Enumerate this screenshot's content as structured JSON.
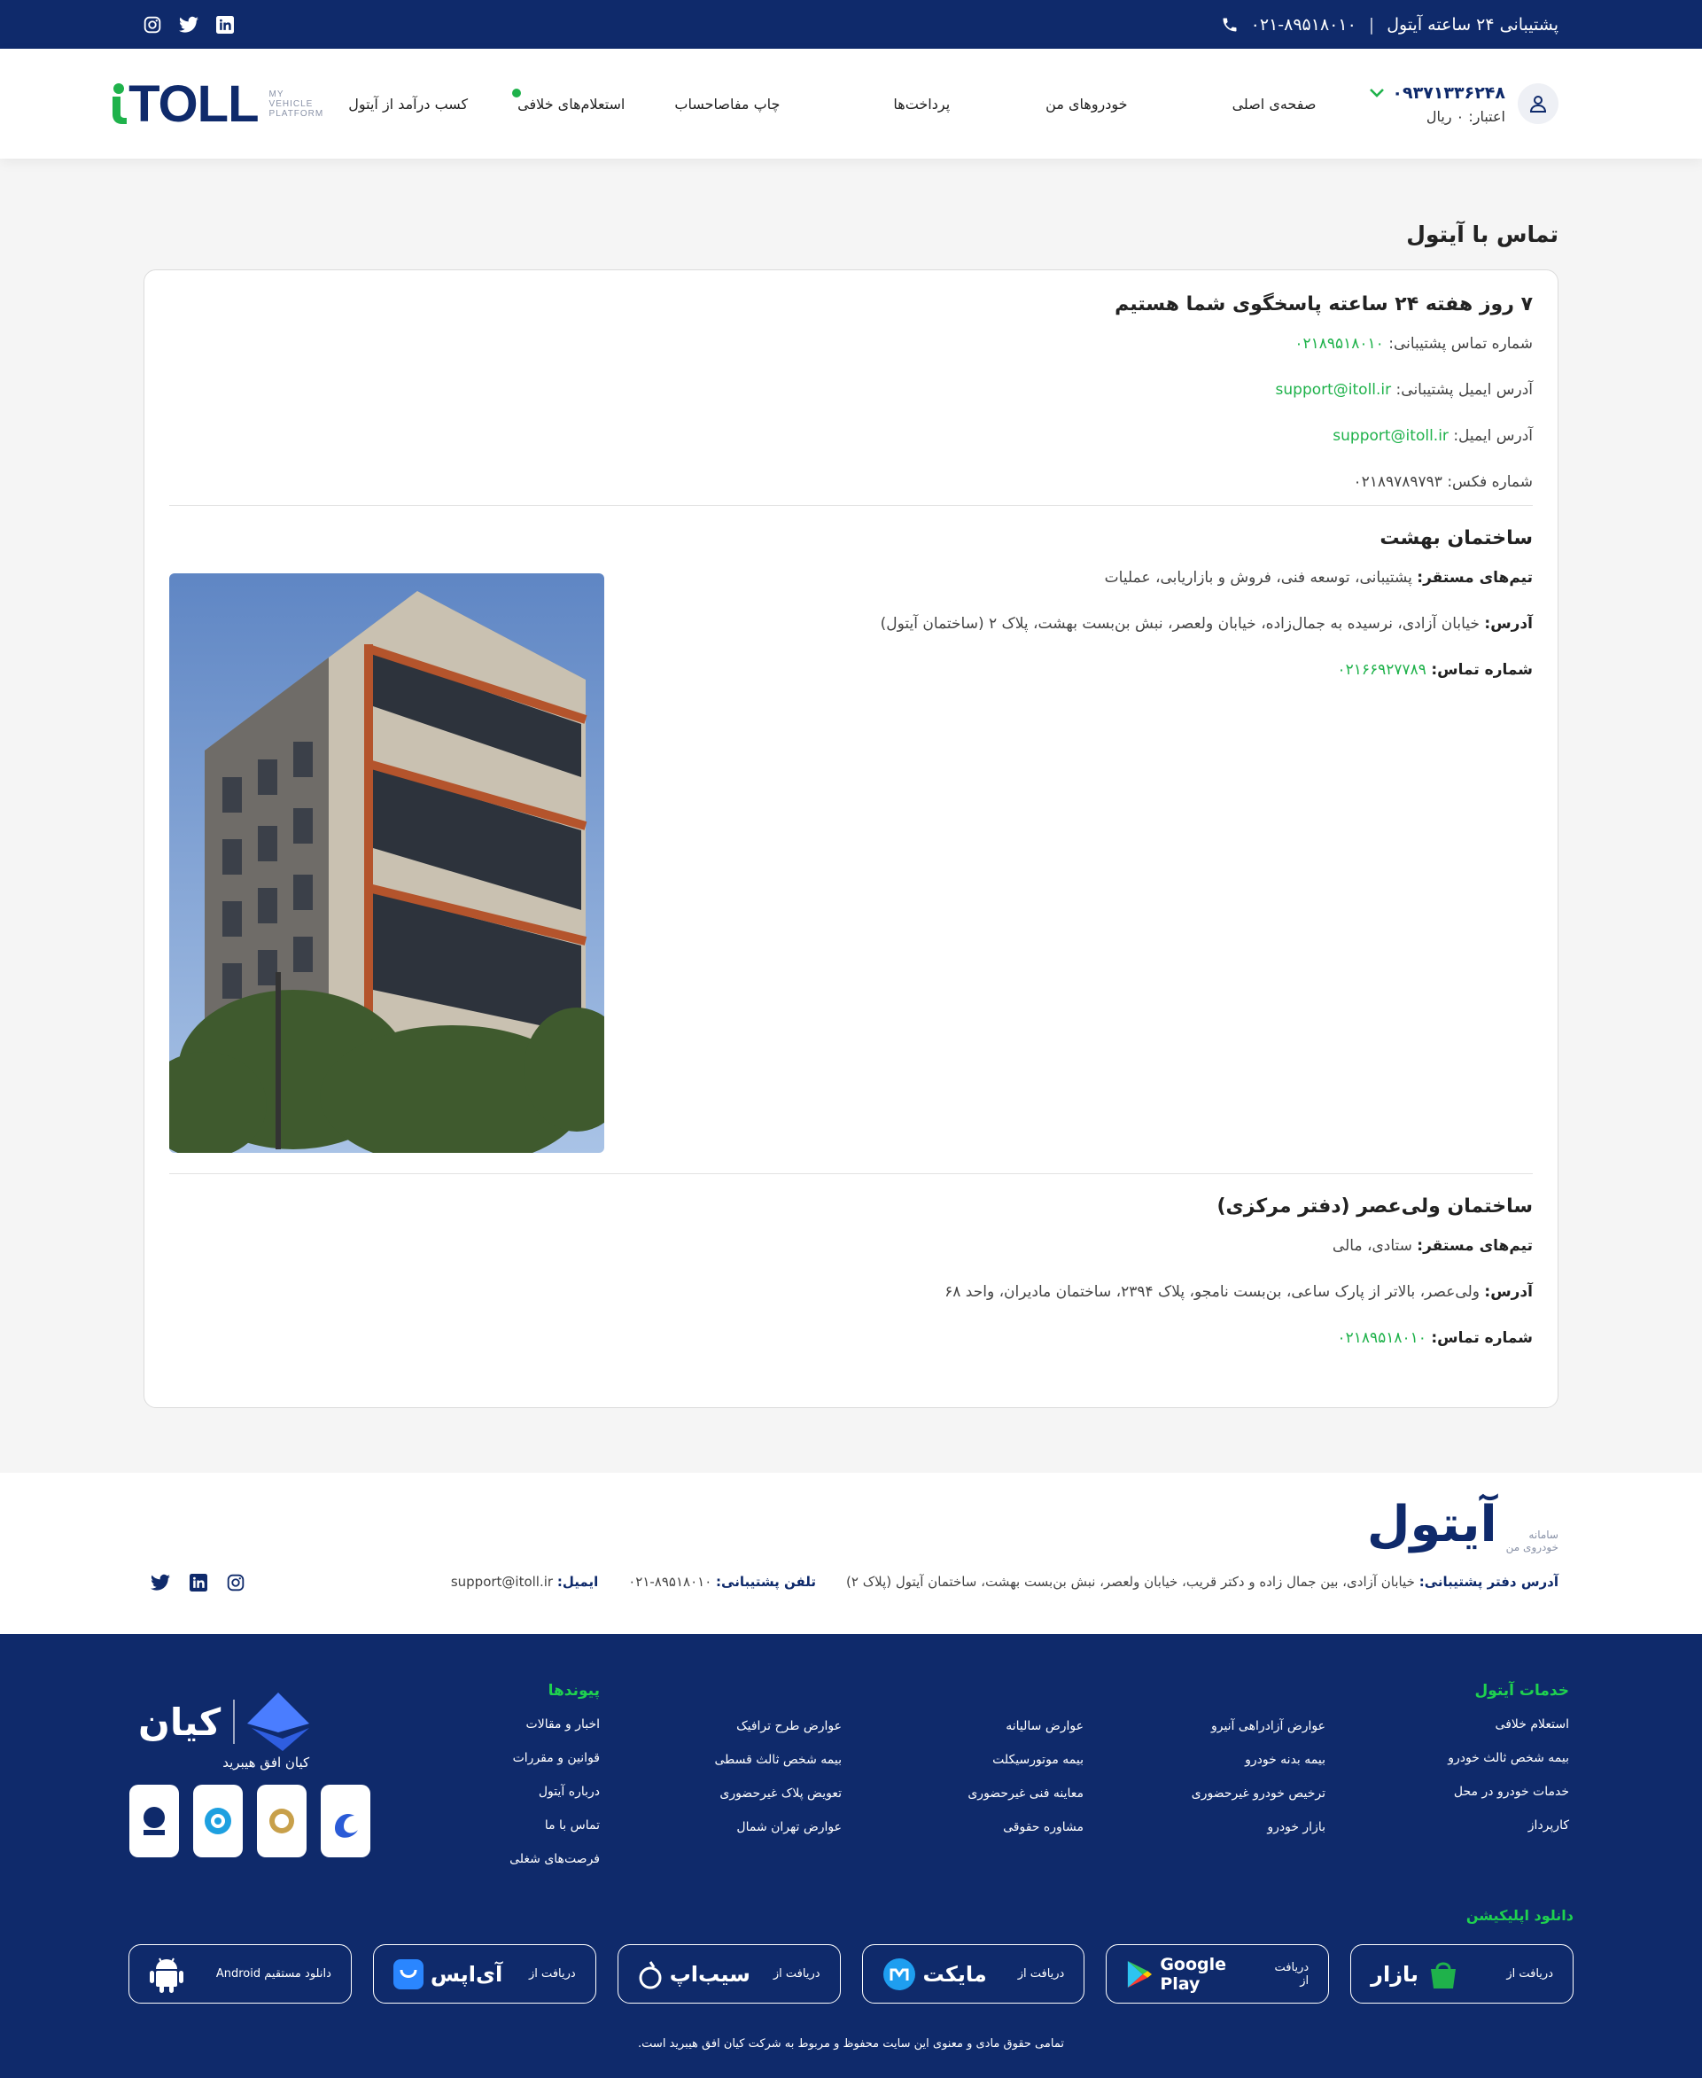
{
  "topbar": {
    "support_label": "پشتیبانی ۲۴ ساعته آیتول",
    "separator": "|",
    "phone": "۰۲۱-۸۹۵۱۸۰۱۰",
    "socials": [
      "instagram-icon",
      "twitter-icon",
      "linkedin-icon"
    ]
  },
  "header": {
    "user_phone": "۰۹۳۷۱۳۳۶۲۴۸",
    "credit": "اعتبار: ۰ ریال",
    "nav": [
      "صفحه‌ی اصلی",
      "خودروهای من",
      "پرداخت‌ها",
      "چاپ مفاصاحساب",
      "استعلام‌های خلافی",
      "کسب درآمد از آیتول"
    ],
    "logo_text": "TOLL",
    "logo_tagline": [
      "MY",
      "VEHICLE",
      "PLATFORM"
    ]
  },
  "page": {
    "title": "تماس با آیتول",
    "contact": {
      "heading": "۷ روز هفته ۲۴ ساعته پاسخگوی شما هستیم",
      "support_phone_label": "شماره تماس پشتیبانی:",
      "support_phone": "۰۲۱۸۹۵۱۸۰۱۰",
      "support_email_label": "آدرس ایمیل پشتیبانی:",
      "support_email": "support@itoll.ir",
      "email_label": "آدرس ایمیل:",
      "email": "support@itoll.ir",
      "fax_label": "شماره فکس:",
      "fax": "۰۲۱۸۹۷۸۹۷۹۳"
    },
    "behesht": {
      "heading": "ساختمان بهشت",
      "teams_label": "تیم‌های مستقر:",
      "teams": "پشتیبانی، توسعه فنی، فروش و بازاریابی، عملیات",
      "address_label": "آدرس:",
      "address": "خیابان آزادی، نرسیده به جمال‌زاده، خیابان ولعصر، نبش بن‌بست بهشت، پلاک ۲ (ساختمان آیتول)",
      "phone_label": "شماره تماس:",
      "phone": "۰۲۱۶۶۹۲۷۷۸۹"
    },
    "valiasr": {
      "heading": "ساختمان ولی‌عصر (دفتر مرکزی)",
      "teams_label": "تیم‌های مستقر:",
      "teams": "ستادی، مالی",
      "address_label": "آدرس:",
      "address": "ولی‌عصر، بالاتر از پارک ساعی، بن‌بست نامجو، پلاک ۲۳۹۴، ساختمان مادیران، واحد ۶۸",
      "phone_label": "شماره تماس:",
      "phone": "۰۲۱۸۹۵۱۸۰۱۰"
    }
  },
  "footer_top": {
    "logo_text": "آیتول",
    "logo_small": [
      "سامانه",
      "خودروی من"
    ],
    "address_label": "آدرس دفتر پشتیبانی:",
    "address": "خیابان آزادی، بین جمال زاده و دکتر قریب، خیابان ولعصر، نبش بن‌بست بهشت، ساختمان آیتول (پلاک ۲)",
    "phone_label": "تلفن پشتیبانی:",
    "phone": "۰۲۱-۸۹۵۱۸۰۱۰",
    "email_label": "ایمیل:",
    "email": "support@itoll.ir"
  },
  "footer": {
    "services_title": "خدمات آیتول",
    "col1": [
      "استعلام خلافی",
      "بیمه شخص ثالث خودرو",
      "خدمات خودرو در محل",
      "کارپرداز"
    ],
    "col2": [
      "عوارض آزادراهی آنیرو",
      "بیمه بدنه خودرو",
      "ترخیص خودرو غیرحضوری",
      "بازار خودرو"
    ],
    "col3": [
      "عوارض سالیانه",
      "بیمه موتورسیکلت",
      "معاینه فنی غیرحضوری",
      "مشاوره حقوقی"
    ],
    "col4": [
      "عوارض طرح ترافیک",
      "بیمه شخص ثالث قسطی",
      "تعویض پلاک غیرحضوری",
      "عوارض تهران شمال"
    ],
    "links_title": "پیوندها",
    "links": [
      "اخبار و مقالات",
      "قوانین و مقررات",
      "درباره آیتول",
      "تماس با ما",
      "فرصت‌های شغلی"
    ],
    "kian_name": "کیان",
    "kian_sub": "کیان افق هیبرید",
    "download_title": "دانلود اپلیکیشن",
    "from": "دریافت از",
    "stores": [
      "بازار",
      "Google Play",
      "مایکت",
      "سیب‌اپ",
      "آی‌اپس"
    ],
    "android_direct": "دانلود مستقیم Android",
    "copyright": "تمامی حقوق مادی و معنوی این سایت محفوظ و مربوط به شرکت کیان افق هیبرید است."
  },
  "colors": {
    "navy": "#0f2a6b",
    "green": "#1fb24b"
  }
}
